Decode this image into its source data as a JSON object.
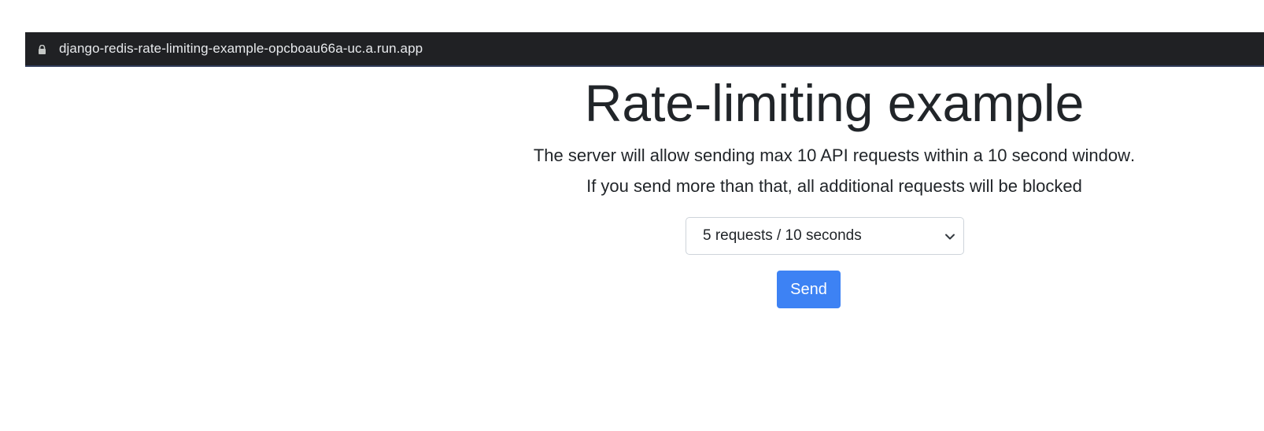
{
  "browser": {
    "url": "django-redis-rate-limiting-example-opcboau66a-uc.a.run.app",
    "lock_icon": "lock-icon"
  },
  "main": {
    "title": "Rate-limiting example",
    "description_prefix": "The server will allow sending ",
    "description_bold": "max 10 API requests within a 10 second window",
    "description_suffix": ".",
    "description_line2": "If you send more than that, all additional requests will be blocked",
    "rate_select": {
      "selected": "5 requests / 10 seconds",
      "icon": "chevron-down-icon"
    },
    "send_label": "Send"
  },
  "colors": {
    "accent": "#3d82f4",
    "text": "#212529",
    "browser_bar": "#202124"
  }
}
